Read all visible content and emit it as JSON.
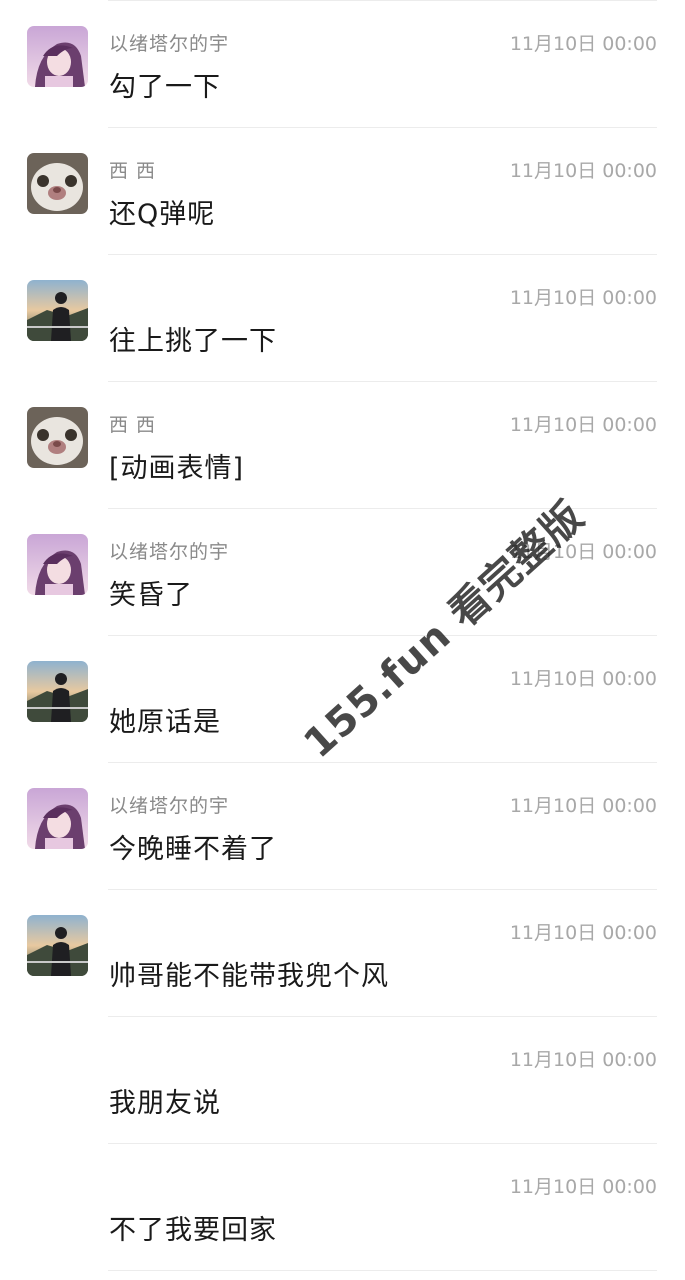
{
  "messages": [
    {
      "sender": "以绪塔尔的宇",
      "time": "11月10日 00:00",
      "text": "勾了一下",
      "avatar": "anime-girl-avatar"
    },
    {
      "sender": "西 西",
      "time": "11月10日 00:00",
      "text": "还Q弹呢",
      "avatar": "panda-avatar"
    },
    {
      "sender": "",
      "time": "11月10日 00:00",
      "text": "往上挑了一下",
      "avatar": "person-scenery-avatar"
    },
    {
      "sender": "西 西",
      "time": "11月10日 00:00",
      "text": "[动画表情]",
      "avatar": "panda-avatar"
    },
    {
      "sender": "以绪塔尔的宇",
      "time": "11月10日 00:00",
      "text": "笑昏了",
      "avatar": "anime-girl-avatar"
    },
    {
      "sender": "",
      "time": "11月10日 00:00",
      "text": "她原话是",
      "avatar": "person-scenery-avatar"
    },
    {
      "sender": "以绪塔尔的宇",
      "time": "11月10日 00:00",
      "text": "今晚睡不着了",
      "avatar": "anime-girl-avatar"
    },
    {
      "sender": "",
      "time": "11月10日 00:00",
      "text": "帅哥能不能带我兜个风",
      "avatar": "person-scenery-avatar"
    },
    {
      "sender": "",
      "time": "11月10日 00:00",
      "text": "我朋友说",
      "avatar": ""
    },
    {
      "sender": "",
      "time": "11月10日 00:00",
      "text": "不了我要回家",
      "avatar": ""
    }
  ],
  "watermark": "155.fun 看完整版"
}
